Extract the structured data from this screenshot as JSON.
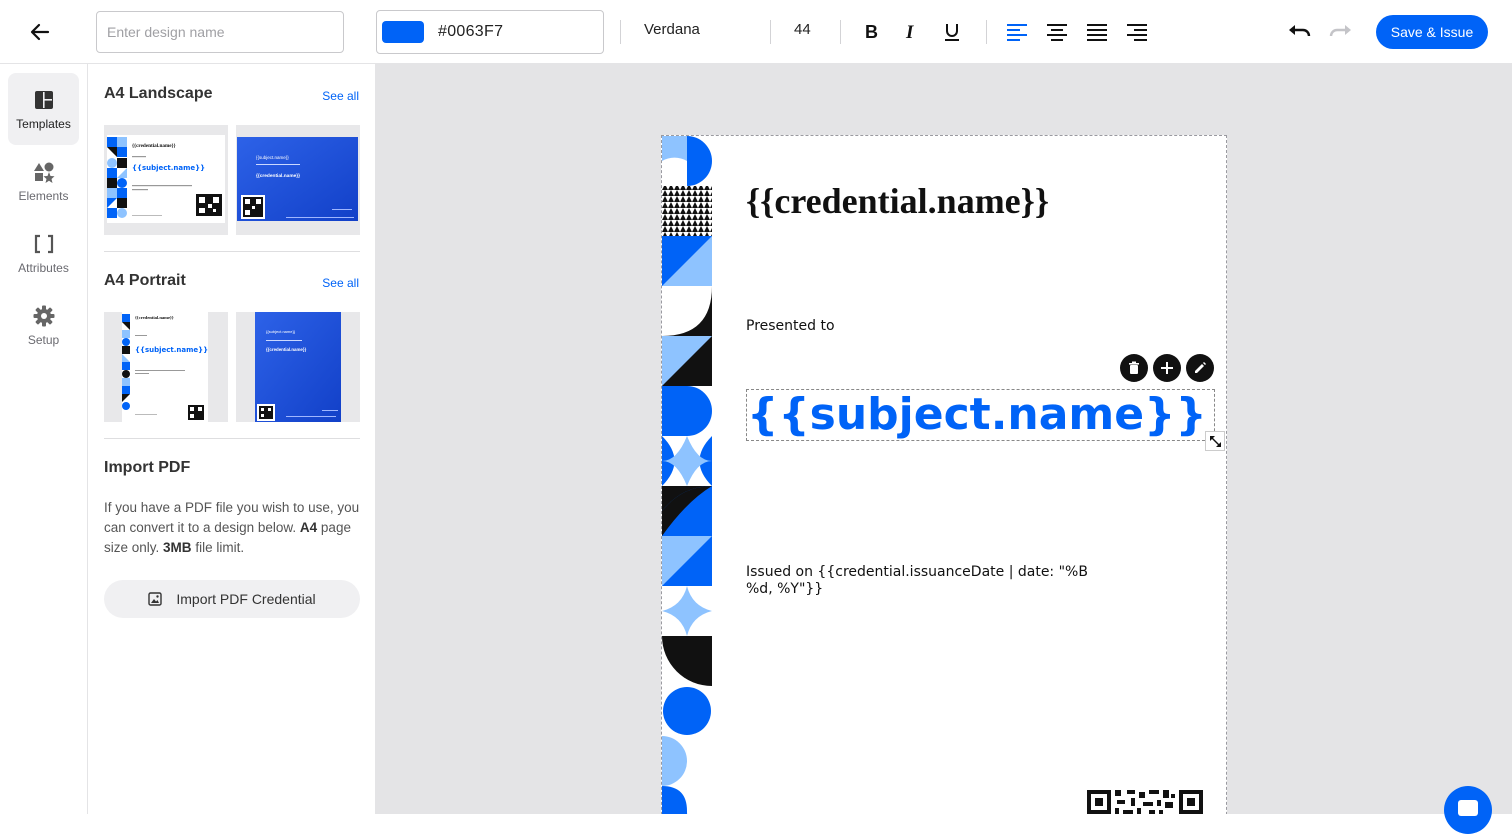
{
  "toolbar": {
    "design_name_placeholder": "Enter design name",
    "color_hex": "#0063F7",
    "font": "Verdana",
    "font_size": "44",
    "save_label": "Save & Issue"
  },
  "rail": {
    "items": [
      {
        "label": "Templates",
        "icon": "templates-icon"
      },
      {
        "label": "Elements",
        "icon": "shapes-icon"
      },
      {
        "label": "Attributes",
        "icon": "brackets-icon"
      },
      {
        "label": "Setup",
        "icon": "gear-icon"
      }
    ]
  },
  "panel": {
    "landscape_title": "A4 Landscape",
    "portrait_title": "A4 Portrait",
    "see_all": "See all",
    "import_title": "Import PDF",
    "import_text_1": "If you have a PDF file you wish to use, you can convert it to a design below.",
    "import_bold_1": "A4",
    "import_text_2": "page size only.",
    "import_bold_2": "3MB",
    "import_text_3": "file limit.",
    "import_button": "Import PDF Credential"
  },
  "thumbs": {
    "credential_name": "{{credential.name}}",
    "subject_name": "{{subject.name}}"
  },
  "canvas": {
    "title": "{{credential.name}}",
    "presented": "Presented to",
    "subject": "{{subject.name}}",
    "issued_line1": "Issued on {{credential.issuanceDate | date: \"%B",
    "issued_line2": "%d, %Y\"}}"
  },
  "colors": {
    "accent": "#0063F7",
    "light_blue": "#8EC3FF"
  }
}
